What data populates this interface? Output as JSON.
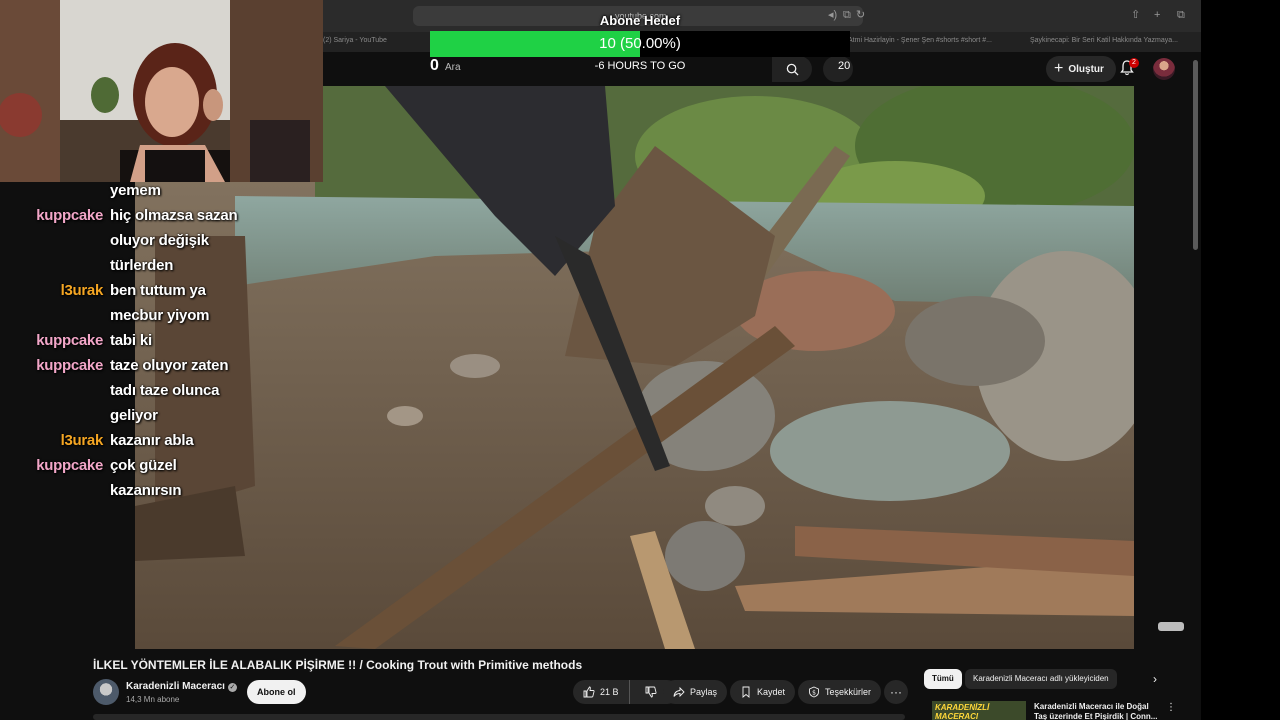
{
  "browser": {
    "url": "youtube.com",
    "tabs": [
      "(2) Sariya - YouTube",
      "Atmi Hazirlayin - Şener Şen #shorts #short #...",
      "Şaykinecapi: Bir Seri Katil Hakkında Yazmaya..."
    ]
  },
  "overlay": {
    "goal_title": "Abone Hedef",
    "goal_progress_text": "10 (50.00%)",
    "goal_progress": 0.5,
    "goal_count": "0",
    "goal_sub": "Ara",
    "goal_timer": "-6 HOURS TO GO",
    "goal_right": "20",
    "fill_color": "#1fd145"
  },
  "header": {
    "create_label": "Oluştur",
    "notification_count": "2"
  },
  "chat": [
    {
      "user": "",
      "text": "yemem",
      "color": "#ffffff"
    },
    {
      "user": "kuppcake",
      "text": "hiç olmazsa sazan",
      "color": "#f2a6c8"
    },
    {
      "user": "",
      "text": "oluyor değişik",
      "color": "#ffffff"
    },
    {
      "user": "",
      "text": "türlerden",
      "color": "#ffffff"
    },
    {
      "user": "l3urak",
      "text": "ben tuttum ya",
      "color": "#f5a623"
    },
    {
      "user": "",
      "text": "mecbur yiyom",
      "color": "#ffffff"
    },
    {
      "user": "kuppcake",
      "text": "tabi ki",
      "color": "#f2a6c8"
    },
    {
      "user": "kuppcake",
      "text": "taze oluyor zaten",
      "color": "#f2a6c8"
    },
    {
      "user": "",
      "text": "tadı taze olunca",
      "color": "#ffffff"
    },
    {
      "user": "",
      "text": "geliyor",
      "color": "#ffffff"
    },
    {
      "user": "l3urak",
      "text": "kazanır abla",
      "color": "#f5a623"
    },
    {
      "user": "kuppcake",
      "text": "çok güzel",
      "color": "#f2a6c8"
    },
    {
      "user": "",
      "text": "kazanırsın",
      "color": "#ffffff"
    }
  ],
  "video": {
    "title": "İLKEL YÖNTEMLER İLE ALABALIK PİŞİRME !! / Cooking Trout with Primitive methods",
    "channel": "Karadenizli Maceracı",
    "subscribers": "14,3 Mn abone",
    "subscribe_label": "Abone ol",
    "likes": "21 B",
    "share_label": "Paylaş",
    "save_label": "Kaydet",
    "thanks_label": "Teşekkürler",
    "more_label": "···"
  },
  "recommendations": {
    "chip_all": "Tümü",
    "chip_uploader": "Karadenizli Maceracı adlı yükleyiciden",
    "first_title": "Karadenizli Maceracı ile Doğal Taş üzerinde Et Pişirdik | Conn...",
    "first_thumb_text": "KARADENİZLİ MACERACI"
  }
}
